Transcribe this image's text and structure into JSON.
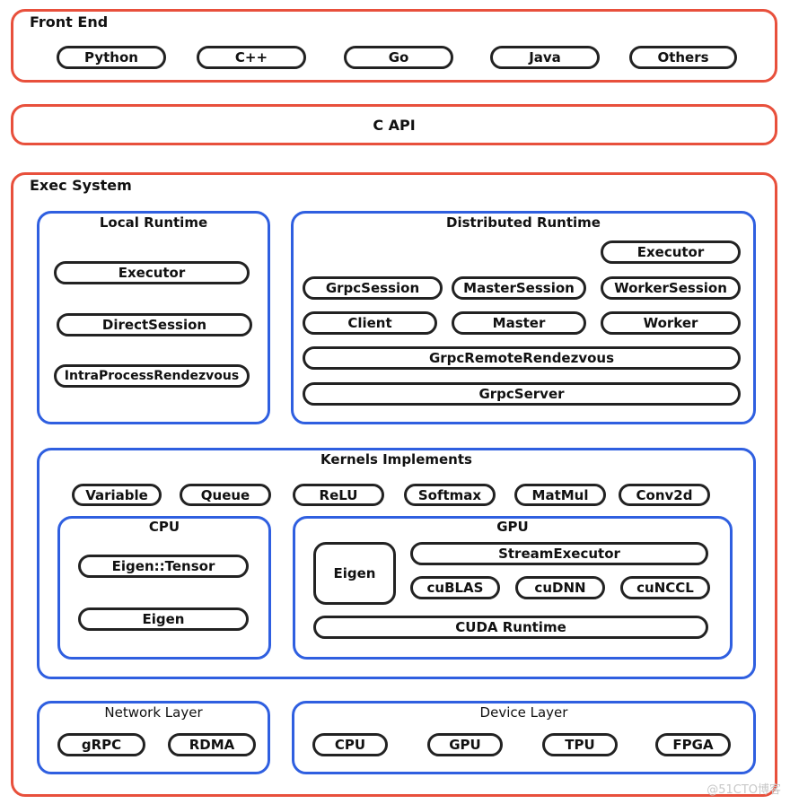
{
  "front_end": {
    "title": "Front End",
    "items": [
      "Python",
      "C++",
      "Go",
      "Java",
      "Others"
    ]
  },
  "c_api": {
    "title": "C API"
  },
  "exec_system": {
    "title": "Exec System",
    "local_runtime": {
      "title": "Local Runtime",
      "items": [
        "Executor",
        "DirectSession",
        "IntraProcessRendezvous"
      ]
    },
    "distributed_runtime": {
      "title": "Distributed Runtime",
      "executor": "Executor",
      "row1": [
        "GrpcSession",
        "MasterSession",
        "WorkerSession"
      ],
      "row2": [
        "Client",
        "Master",
        "Worker"
      ],
      "rendezvous": "GrpcRemoteRendezvous",
      "server": "GrpcServer"
    },
    "kernels": {
      "title": "Kernels Implements",
      "ops": [
        "Variable",
        "Queue",
        "ReLU",
        "Softmax",
        "MatMul",
        "Conv2d"
      ],
      "cpu": {
        "title": "CPU",
        "items": [
          "Eigen::Tensor",
          "Eigen"
        ]
      },
      "gpu": {
        "title": "GPU",
        "eigen": "Eigen",
        "stream_executor": "StreamExecutor",
        "libs": [
          "cuBLAS",
          "cuDNN",
          "cuNCCL"
        ],
        "cuda_runtime": "CUDA Runtime"
      }
    },
    "network_layer": {
      "title": "Network Layer",
      "items": [
        "gRPC",
        "RDMA"
      ]
    },
    "device_layer": {
      "title": "Device Layer",
      "items": [
        "CPU",
        "GPU",
        "TPU",
        "FPGA"
      ]
    }
  },
  "watermark": "@51CTO博客",
  "colors": {
    "layer_border": "#e8503c",
    "group_border": "#2f5fe0",
    "pill_border": "#222222"
  }
}
